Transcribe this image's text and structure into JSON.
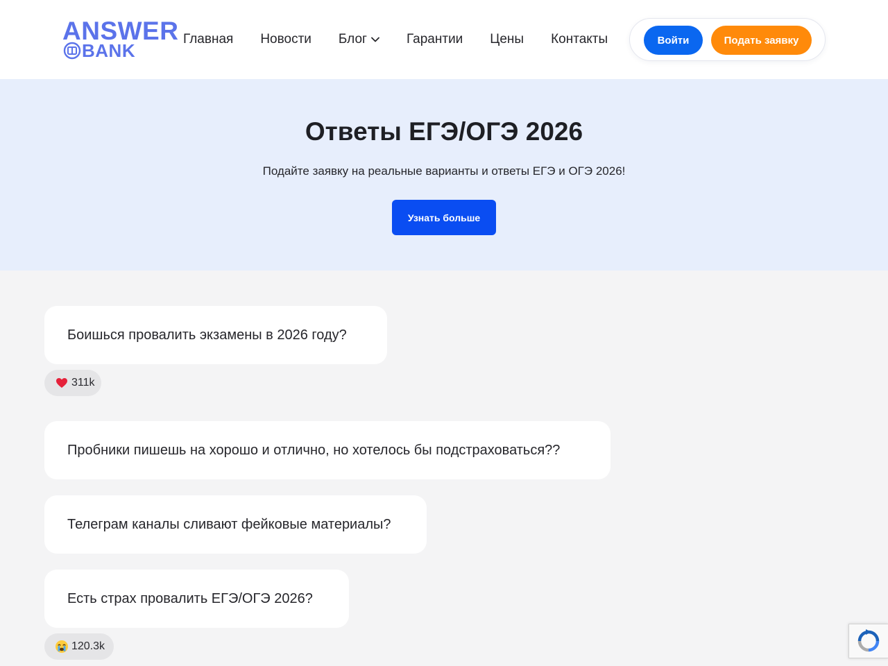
{
  "logo": {
    "top": "ANSWER",
    "bottom": "BANK"
  },
  "nav": {
    "items": [
      {
        "label": "Главная"
      },
      {
        "label": "Новости"
      },
      {
        "label": "Блог",
        "has_dropdown": true
      },
      {
        "label": "Гарантии"
      },
      {
        "label": "Цены"
      },
      {
        "label": "Контакты"
      }
    ]
  },
  "auth": {
    "login_label": "Войти",
    "apply_label": "Подать заявку"
  },
  "hero": {
    "title": "Ответы ЕГЭ/ОГЭ 2026",
    "subtitle": "Подайте заявку на реальные варианты и ответы ЕГЭ и ОГЭ 2026!",
    "cta_label": "Узнать больше"
  },
  "messages": [
    {
      "text": "Боишься провалить экзамены в 2026 году?",
      "reaction": {
        "icon": "heart-icon",
        "count": "311k"
      }
    },
    {
      "text": "Пробники пишешь на хорошо и отлично, но хотелось бы подстраховаться??"
    },
    {
      "text": "Телеграм каналы сливают фейковые материалы?"
    },
    {
      "text": "Есть страх провалить ЕГЭ/ОГЭ 2026?",
      "reaction": {
        "icon": "crying-face-icon",
        "count": "120.3k"
      }
    }
  ],
  "colors": {
    "brand": "#5b73ea",
    "primary_blue": "#0a67f0",
    "cta_blue": "#0a4df2",
    "accent_orange": "#ff8a0a",
    "hero_bg": "#e7eefc",
    "page_bg": "#f4f4f5"
  },
  "widgets": {
    "recaptcha_icon": "recaptcha-icon"
  }
}
